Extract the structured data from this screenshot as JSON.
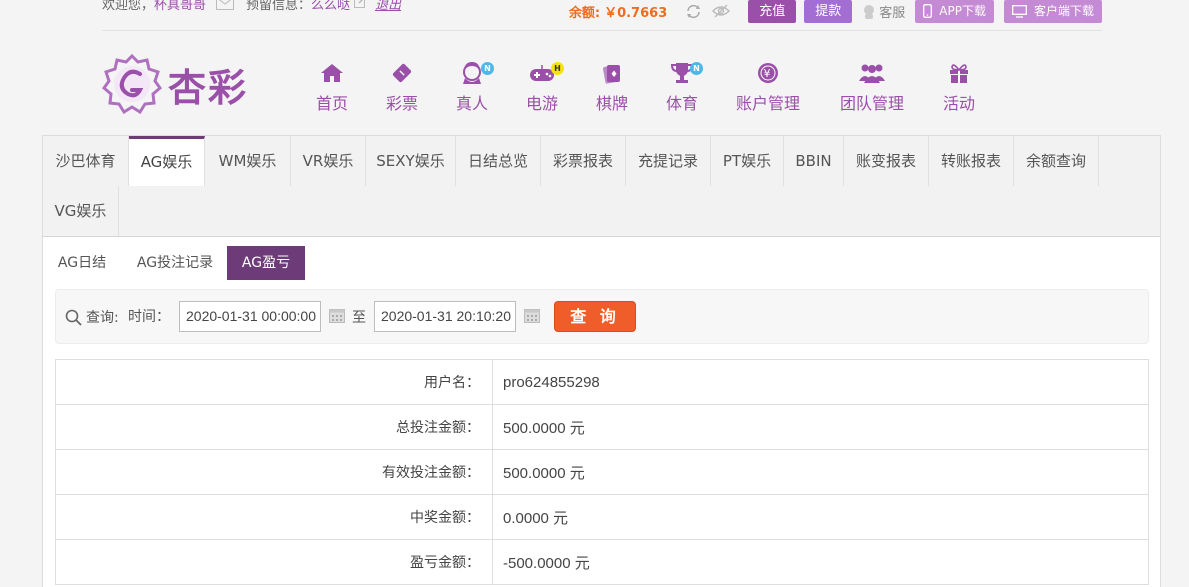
{
  "topbar": {
    "welcome_prefix": "欢迎您，",
    "username_display": "杯具哥哥",
    "notice_label": "预留信息：",
    "notice_value": "么么哒",
    "logout": "退出",
    "balance_label": "余额:",
    "balance_value": "￥0.7663",
    "deposit": "充值",
    "withdraw": "提款",
    "service": "客服",
    "app_download": "APP下载",
    "client_download": "客户端下载"
  },
  "logo": {
    "text": "杏彩"
  },
  "nav": [
    {
      "label": "首页",
      "icon": "home-icon"
    },
    {
      "label": "彩票",
      "icon": "ticket-icon"
    },
    {
      "label": "真人",
      "icon": "live-dealer-icon",
      "badge": "N"
    },
    {
      "label": "电游",
      "icon": "gamepad-icon",
      "badge": "H"
    },
    {
      "label": "棋牌",
      "icon": "cards-icon"
    },
    {
      "label": "体育",
      "icon": "trophy-icon",
      "badge": "N"
    },
    {
      "label": "账户管理",
      "icon": "account-icon"
    },
    {
      "label": "团队管理",
      "icon": "team-icon"
    },
    {
      "label": "活动",
      "icon": "gift-icon"
    }
  ],
  "tabs": [
    "沙巴体育",
    "AG娱乐",
    "WM娱乐",
    "VR娱乐",
    "SEXY娱乐",
    "日结总览",
    "彩票报表",
    "充提记录",
    "PT娱乐",
    "BBIN",
    "账变报表",
    "转账报表",
    "余额查询",
    "VG娱乐"
  ],
  "active_tab": "AG娱乐",
  "subtabs": [
    "AG日结",
    "AG投注记录",
    "AG盈亏"
  ],
  "active_subtab": "AG盈亏",
  "search": {
    "query_label": "查询:",
    "time_label": "时间：",
    "start_time": "2020-01-31 00:00:00",
    "to_label": "至",
    "end_time": "2020-01-31 20:10:20",
    "query_button": "查 询"
  },
  "result": [
    {
      "key": "用户名：",
      "value": "pro624855298"
    },
    {
      "key": "总投注金额：",
      "value": "500.0000 元"
    },
    {
      "key": "有效投注金额：",
      "value": "500.0000 元"
    },
    {
      "key": "中奖金额：",
      "value": "0.0000 元"
    },
    {
      "key": "盈亏金额：",
      "value": "-500.0000 元"
    }
  ],
  "colors": {
    "brand": "#9a4fa8",
    "accent": "#ef5d2a",
    "balance": "#f26b1d",
    "tab_active": "#6c3b78"
  }
}
